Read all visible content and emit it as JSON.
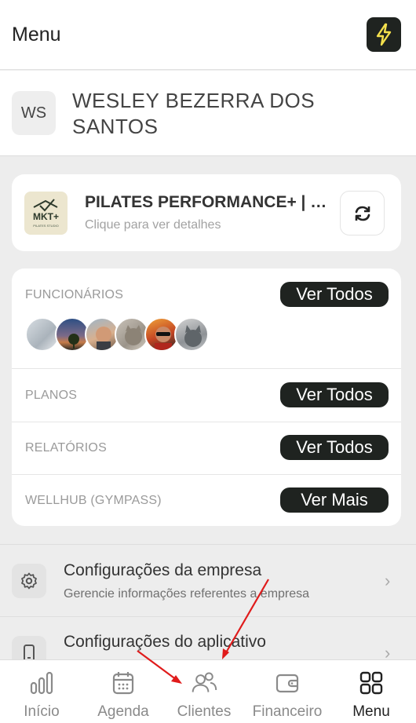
{
  "header": {
    "title": "Menu",
    "action_icon": "lightning-bolt-icon"
  },
  "user": {
    "initials": "WS",
    "name": "WESLEY BEZERRA DOS SANTOS"
  },
  "company": {
    "name": "PILATES PERFORMANCE+ | M...",
    "subtitle": "Clique para ver detalhes",
    "logo_text": "MKT+",
    "logo_subtext": "PILATES STUDIO",
    "switch_icon": "swap-icon"
  },
  "sections": [
    {
      "label": "FUNCIONÁRIOS",
      "button": "Ver Todos"
    },
    {
      "label": "PLANOS",
      "button": "Ver Todos"
    },
    {
      "label": "RELATÓRIOS",
      "button": "Ver Todos"
    },
    {
      "label": "WELLHUB (GYMPASS)",
      "button": "Ver Mais"
    }
  ],
  "settings": [
    {
      "title": "Configurações da empresa",
      "subtitle": "Gerencie informações referentes a empresa",
      "icon": "gear-icon"
    },
    {
      "title": "Configurações do aplicativo",
      "subtitle": "",
      "icon": "phone-icon"
    }
  ],
  "tabs": [
    {
      "label": "Início",
      "icon": "bar-chart-icon",
      "active": false
    },
    {
      "label": "Agenda",
      "icon": "calendar-icon",
      "active": false
    },
    {
      "label": "Clientes",
      "icon": "users-icon",
      "active": false
    },
    {
      "label": "Financeiro",
      "icon": "wallet-icon",
      "active": false
    },
    {
      "label": "Menu",
      "icon": "grid-icon",
      "active": true
    }
  ],
  "colors": {
    "dark": "#1f2320",
    "bolt": "#f4e04d",
    "background": "#ededed",
    "annotation_arrow": "#e01b1b"
  }
}
